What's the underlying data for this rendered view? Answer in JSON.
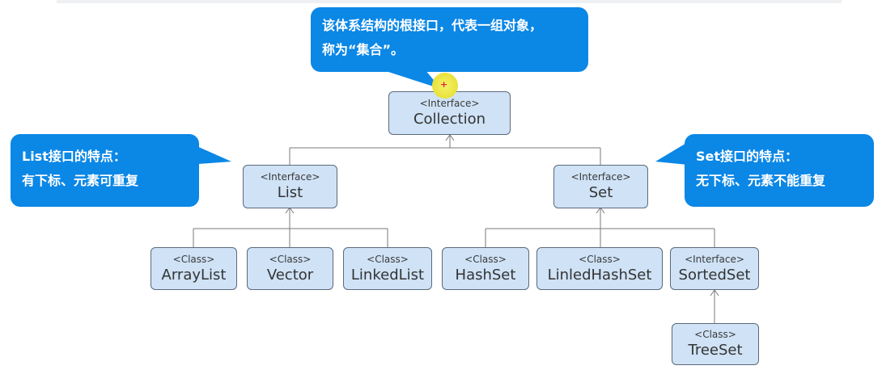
{
  "title": "",
  "nodes": {
    "collection": {
      "stereotype": "<Interface>",
      "name": "Collection"
    },
    "list": {
      "stereotype": "<Interface>",
      "name": "List"
    },
    "set": {
      "stereotype": "<Interface>",
      "name": "Set"
    },
    "arraylist": {
      "stereotype": "<Class>",
      "name": "ArrayList"
    },
    "vector": {
      "stereotype": "<Class>",
      "name": "Vector"
    },
    "linkedlist": {
      "stereotype": "<Class>",
      "name": "LinkedList"
    },
    "hashset": {
      "stereotype": "<Class>",
      "name": "HashSet"
    },
    "linledhashset": {
      "stereotype": "<Class>",
      "name": "LinledHashSet"
    },
    "sortedset": {
      "stereotype": "<Interface>",
      "name": "SortedSet"
    },
    "treeset": {
      "stereotype": "<Class>",
      "name": "TreeSet"
    }
  },
  "callouts": {
    "collection": {
      "line1": "该体系结构的根接口，代表一组对象，",
      "line2": "称为“集合”。"
    },
    "list": {
      "line1": "List接口的特点：",
      "line2": "有下标、元素可重复"
    },
    "set": {
      "line1": "Set接口的特点：",
      "line2": "无下标、元素不能重复"
    }
  },
  "colors": {
    "node_fill": "#cfe2f6",
    "node_border": "#5b6a7a",
    "callout_fill": "#0b87e6",
    "callout_text": "#ffffff",
    "connector": "#7a7a7a",
    "cursor_highlight": "#f2ee5a"
  }
}
